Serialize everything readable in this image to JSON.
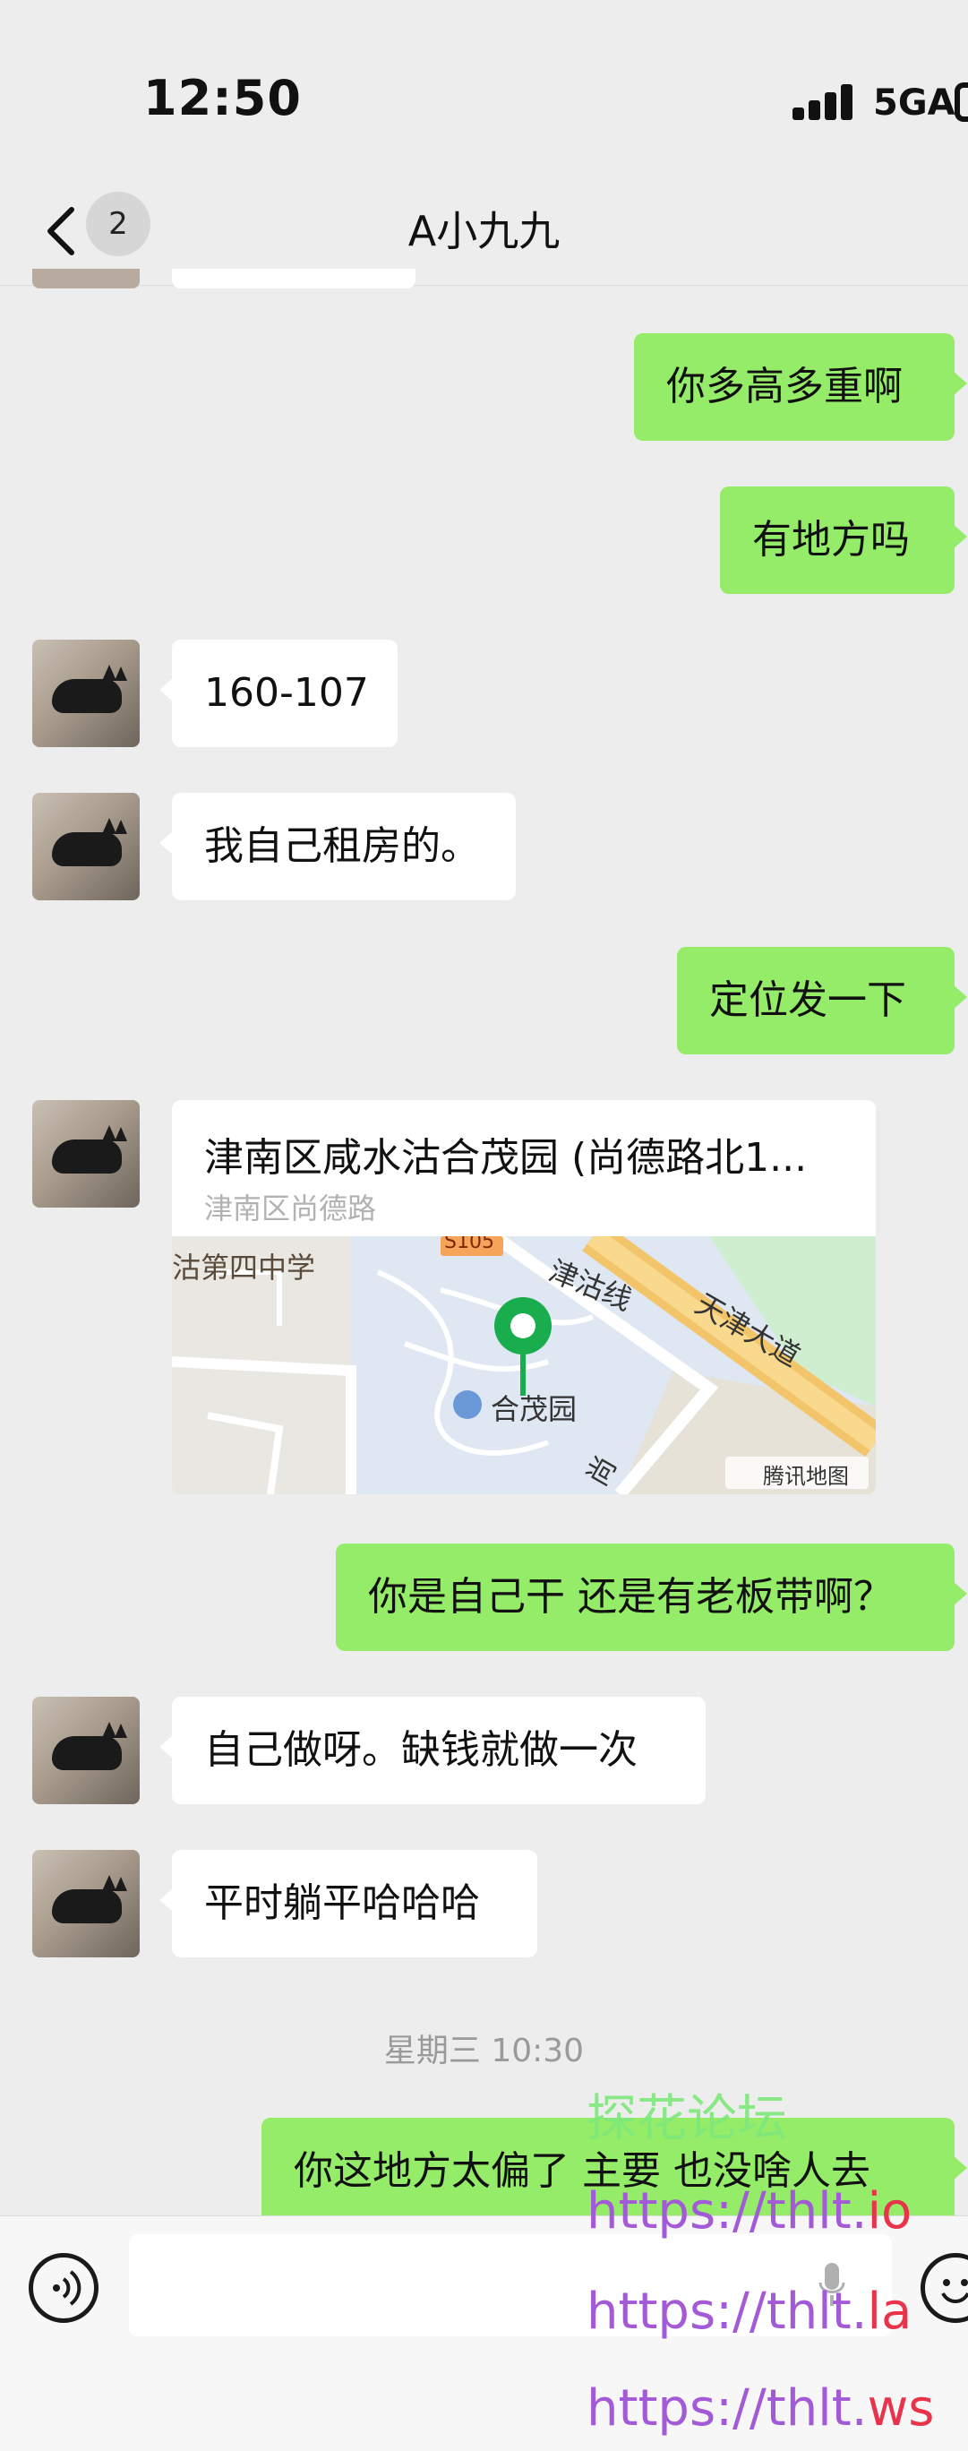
{
  "status_bar": {
    "time": "12:50",
    "network": "5GA"
  },
  "nav": {
    "unread_count": "2",
    "title": "A小九九"
  },
  "messages": [
    {
      "side": "out",
      "text": "你多高多重啊"
    },
    {
      "side": "out",
      "text": "有地方吗"
    },
    {
      "side": "in",
      "text": "160-107"
    },
    {
      "side": "in",
      "text": "我自己租房的。"
    },
    {
      "side": "out",
      "text": "定位发一下"
    },
    {
      "side": "out",
      "text": "你是自己干 还是有老板带啊？"
    },
    {
      "side": "in",
      "text": "自己做呀。缺钱就做一次"
    },
    {
      "side": "in",
      "text": "平时躺平哈哈哈"
    },
    {
      "side": "out",
      "text": "你这地方太偏了 主要 也没啥人去"
    }
  ],
  "location": {
    "title": "津南区咸水沽合茂园 (尚德路北1...",
    "subtitle": "津南区尚德路",
    "map_labels": {
      "school": "沽第四中学",
      "road_code": "S105",
      "rail": "津沽线",
      "avenue": "天津大道",
      "poi": "合茂园",
      "street": "尚",
      "provider": "腾讯地图"
    }
  },
  "timestamp": "星期三 10:30",
  "watermark": {
    "forum": "探花论坛",
    "url1_a": "https://thlt.",
    "url1_b": "io",
    "url2_a": "https://thlt.",
    "url2_b": "la",
    "url3_a": "https://thlt.",
    "url3_b": "ws"
  },
  "colors": {
    "out_bubble": "#95ec69",
    "in_bubble": "#ffffff",
    "background": "#ededed",
    "watermark_purple": "#a35ad6",
    "watermark_green": "#7ee87a",
    "watermark_red": "#e8334a"
  }
}
